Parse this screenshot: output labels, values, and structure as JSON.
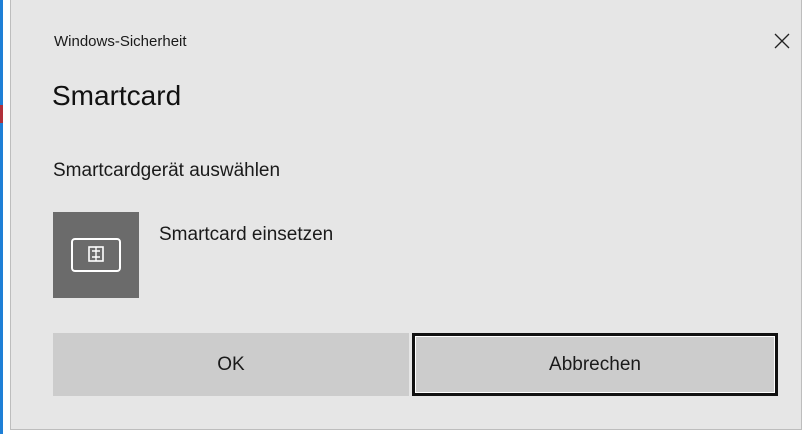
{
  "window": {
    "title": "Windows-Sicherheit"
  },
  "dialog": {
    "heading": "Smartcard",
    "subheading": "Smartcardgerät auswählen",
    "option": {
      "label": "Smartcard einsetzen",
      "icon": "smartcard-icon"
    }
  },
  "buttons": {
    "ok": "OK",
    "cancel": "Abbrechen"
  },
  "icons": {
    "close": "close-icon"
  },
  "colors": {
    "accent_edge": "#1e7fd6",
    "background": "#e6e6e6",
    "button": "#cccccc",
    "tile": "#6b6b6b"
  }
}
